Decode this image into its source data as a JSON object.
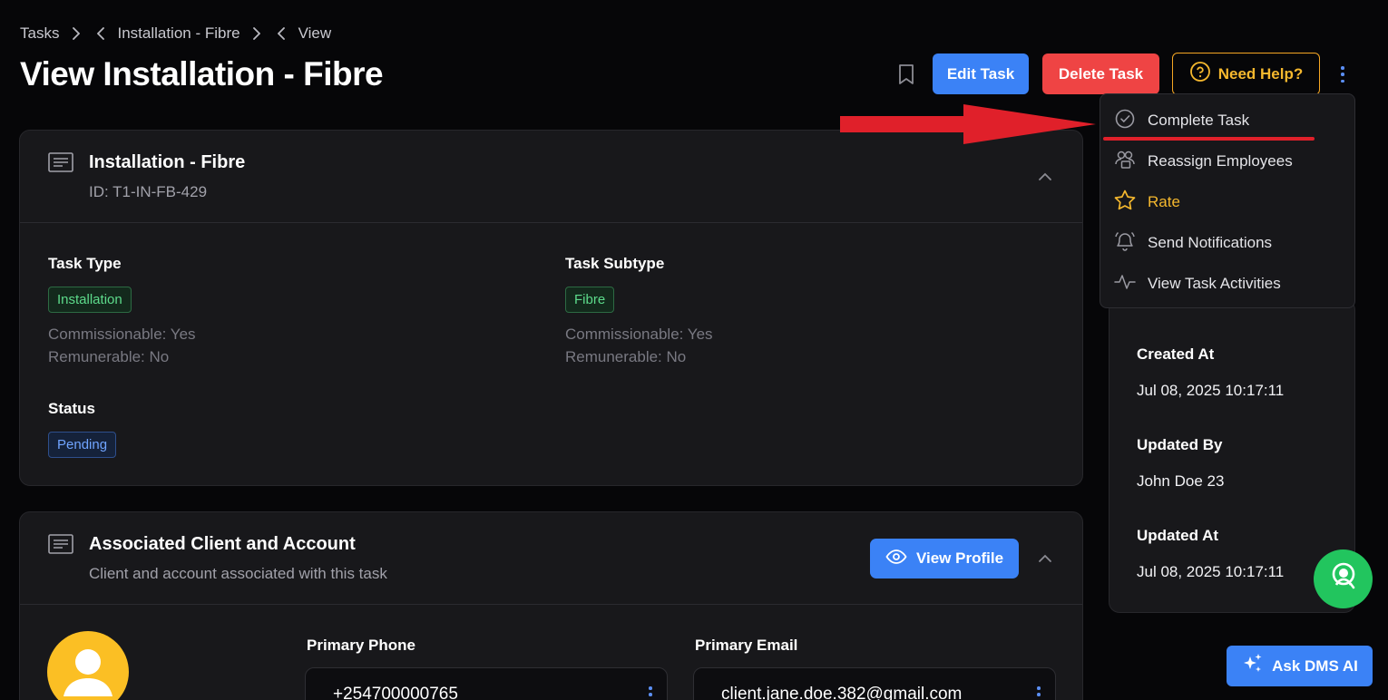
{
  "breadcrumb": {
    "items": [
      "Tasks",
      "Installation - Fibre",
      "View"
    ]
  },
  "page_title": "View Installation - Fibre",
  "header_actions": {
    "edit": "Edit Task",
    "delete": "Delete Task",
    "help": "Need Help?"
  },
  "details_card": {
    "title": "Installation - Fibre",
    "subtitle": "ID: T1-IN-FB-429",
    "task_type": {
      "label": "Task Type",
      "badge": "Installation",
      "commissionable": "Commissionable: Yes",
      "remunerable": "Remunerable: No"
    },
    "task_subtype": {
      "label": "Task Subtype",
      "badge": "Fibre",
      "commissionable": "Commissionable: Yes",
      "remunerable": "Remunerable: No"
    },
    "status": {
      "label": "Status",
      "badge": "Pending"
    }
  },
  "client_card": {
    "title": "Associated Client and Account",
    "subtitle": "Client and account associated with this task",
    "view_profile": "View Profile",
    "primary_phone": {
      "label": "Primary Phone",
      "value": "+254700000765"
    },
    "primary_email": {
      "label": "Primary Email",
      "value": "client.jane.doe.382@gmail.com"
    }
  },
  "dropdown_menu": {
    "items": [
      {
        "label": "Complete Task",
        "icon": "check-circle-icon"
      },
      {
        "label": "Reassign Employees",
        "icon": "users-icon"
      },
      {
        "label": "Rate",
        "icon": "star-icon"
      },
      {
        "label": "Send Notifications",
        "icon": "bell-icon"
      },
      {
        "label": "View Task Activities",
        "icon": "activity-icon"
      }
    ]
  },
  "side_panel": {
    "created_at_label": "Created At",
    "created_at_value": "Jul 08, 2025 10:17:11",
    "updated_by_label": "Updated By",
    "updated_by_value": "John Doe 23",
    "updated_at_label": "Updated At",
    "updated_at_value": "Jul 08, 2025 10:17:11"
  },
  "ai_button": "Ask DMS AI",
  "colors": {
    "background": "#060608",
    "card": "#18181b",
    "primary": "#3b82f6",
    "danger": "#ef4444",
    "warning": "#f5a623",
    "success": "#22c55e",
    "annotation_red": "#e0202a"
  }
}
